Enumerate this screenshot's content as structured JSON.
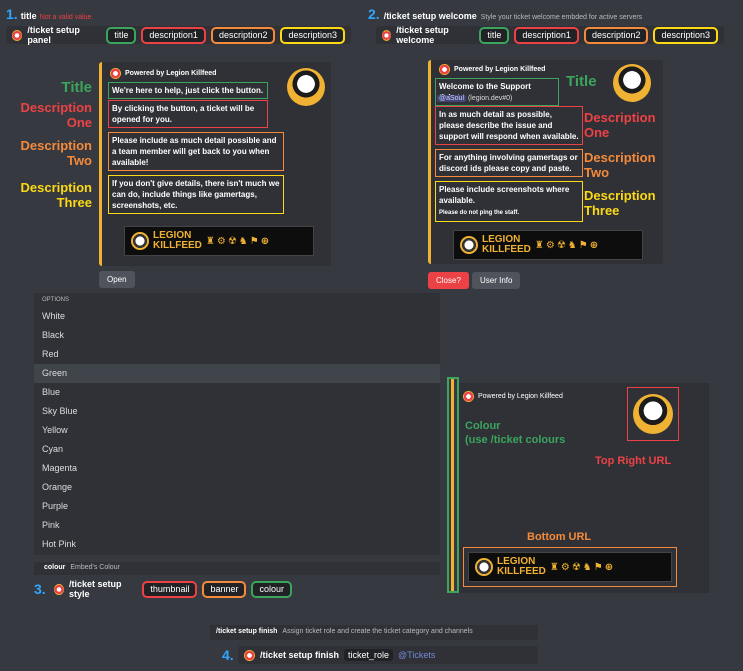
{
  "s1": {
    "num": "1.",
    "title": "title",
    "err": "Not a valid value.",
    "cmd": "/ticket setup panel",
    "chips": [
      "title",
      "description1",
      "description2",
      "description3"
    ]
  },
  "s2": {
    "num": "2.",
    "cmd": "/ticket setup welcome",
    "desc": "Style your ticket welcome embded for active servers",
    "chips": [
      "title",
      "description1",
      "description2",
      "description3"
    ]
  },
  "embed1": {
    "author": "Powered by Legion Killfeed",
    "title": "We're here to help, just click the button.",
    "d1": "By clicking the button, a ticket will be opened for you.",
    "d2": "Please include as much detail possible and a team member will get back to you when available!",
    "d3": "If you don't give details, there isn't much we can do, include things like gamertags, screenshots, etc.",
    "open": "Open"
  },
  "labels1": {
    "title": "Title",
    "d1a": "Description",
    "d1b": "One",
    "d2a": "Description",
    "d2b": "Two",
    "d3a": "Description",
    "d3b": "Three"
  },
  "embed2": {
    "author": "Powered by Legion Killfeed",
    "title": "Welcome to the Support ticket.",
    "mention": "@aSoul",
    "mention_rest": "(legion.dev#0)",
    "d1": "In as much detail as possible, please describe the issue and support will respond when available.",
    "d2": "For anything involving gamertags or discord ids please copy and paste.",
    "d3": "Please include screenshots where available.",
    "d3small": "Please do not ping the staff.",
    "close": "Close?",
    "user": "User Info"
  },
  "labels2": {
    "title": "Title",
    "d1a": "Description",
    "d1b": "One",
    "d2a": "Description",
    "d2b": "Two",
    "d3a": "Description",
    "d3b": "Three"
  },
  "banner": {
    "line1": "LEGION",
    "line2": "KILLFEED"
  },
  "options": {
    "header": "OPTIONS",
    "items": [
      "White",
      "Black",
      "Red",
      "Green",
      "Blue",
      "Sky Blue",
      "Yellow",
      "Cyan",
      "Magenta",
      "Orange",
      "Purple",
      "Pink",
      "Hot Pink"
    ],
    "selected": "Green",
    "param": "colour",
    "param_desc": "Embed's Colour"
  },
  "s3": {
    "num": "3.",
    "cmd": "/ticket setup style",
    "chips": [
      "thumbnail",
      "banner",
      "colour"
    ]
  },
  "embed3": {
    "author": "Powered by Legion Killfeed",
    "colour": "Colour",
    "colour_note": "(use /ticket colours",
    "tr": "Top Right URL",
    "bottom": "Bottom URL"
  },
  "s4": {
    "num": "4.",
    "hint_cmd": "/ticket setup finish",
    "hint_desc": "Assign ticket role and create the ticket category and channels",
    "cmd": "/ticket setup finish",
    "param": "ticket_role",
    "value": "@Tickets"
  }
}
